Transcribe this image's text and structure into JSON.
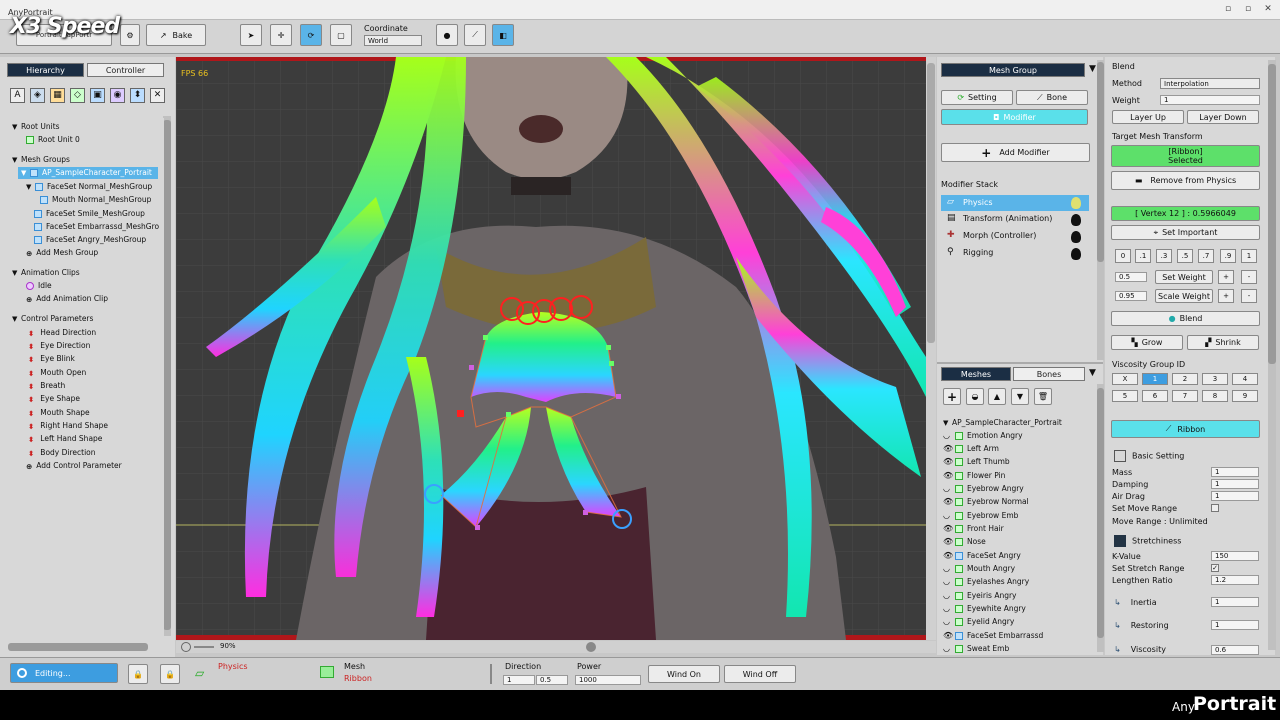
{
  "app": {
    "title": "AnyPortrait",
    "overlay": "X3 Speed"
  },
  "toolbar": {
    "portrait_tab": "Portrait (apPortr",
    "bake_label": "Bake",
    "coordinate_label": "Coordinate",
    "coordinate_value": "World"
  },
  "left": {
    "tabs": [
      "Hierarchy",
      "Controller"
    ],
    "root_units_header": "Root Units",
    "root_unit": "Root Unit 0",
    "mesh_groups_header": "Mesh Groups",
    "mesh_groups": [
      "AP_SampleCharacter_Portrait",
      "FaceSet Normal_MeshGroup",
      "Mouth Normal_MeshGroup",
      "FaceSet Smile_MeshGroup",
      "FaceSet Embarrassd_MeshGro",
      "FaceSet Angry_MeshGroup"
    ],
    "add_mesh_group": "Add Mesh Group",
    "animation_header": "Animation Clips",
    "animation_clips": [
      "Idle"
    ],
    "add_animation": "Add Animation Clip",
    "control_header": "Control Parameters",
    "control_params": [
      "Head Direction",
      "Eye Direction",
      "Eye Blink",
      "Mouth Open",
      "Breath",
      "Eye Shape",
      "Mouth Shape",
      "Right Hand Shape",
      "Left Hand Shape",
      "Body Direction"
    ],
    "add_control": "Add Control Parameter"
  },
  "viewport": {
    "fps": "FPS 66",
    "zoom": "90%"
  },
  "mid": {
    "header": "Mesh Group",
    "setting": "Setting",
    "bone": "Bone",
    "modifier": "Modifier",
    "add_modifier": "Add Modifier",
    "stack_label": "Modifier Stack",
    "modifiers": [
      "Physics",
      "Transform (Animation)",
      "Morph (Controller)",
      "Rigging"
    ],
    "meshes_tab": "Meshes",
    "bones_tab": "Bones",
    "mesh_root": "AP_SampleCharacter_Portrait",
    "meshes": [
      "Emotion Angry",
      "Left Arm",
      "Left Thumb",
      "Flower Pin",
      "Eyebrow Angry",
      "Eyebrow Normal",
      "Eyebrow Emb",
      "Front Hair",
      "Nose",
      "FaceSet Angry",
      "Mouth Angry",
      "Eyelashes Angry",
      "Eyeiris Angry",
      "Eyewhite Angry",
      "Eyelid Angry",
      "FaceSet Embarrassd",
      "Sweat Emb"
    ]
  },
  "right": {
    "blend_title": "Blend",
    "method_label": "Method",
    "method_value": "Interpolation",
    "weight_label": "Weight",
    "weight_value": "1",
    "layer_up": "Layer Up",
    "layer_down": "Layer Down",
    "target_label": "Target Mesh Transform",
    "target_line1": "[Ribbon]",
    "target_line2": "Selected",
    "remove_physics": "Remove from Physics",
    "vertex_label": "[ Vertex 12 ] : 0.5966049",
    "set_important": "Set Important",
    "weight_buttons": [
      "0",
      ".1",
      ".3",
      ".5",
      ".7",
      ".9",
      "1"
    ],
    "set_weight_value": "0.5",
    "set_weight": "Set Weight",
    "scale_weight_value": "0.95",
    "scale_weight": "Scale Weight",
    "blend_btn": "Blend",
    "grow": "Grow",
    "shrink": "Shrink",
    "viscosity_label": "Viscosity Group ID",
    "viscosity": [
      "X",
      "1",
      "2",
      "3",
      "4",
      "5",
      "6",
      "7",
      "8",
      "9"
    ],
    "ribbon_btn": "Ribbon",
    "basic_setting": "Basic Setting",
    "mass_label": "Mass",
    "mass_value": "1",
    "damping_label": "Damping",
    "damping_value": "1",
    "airdrag_label": "Air Drag",
    "airdrag_value": "1",
    "move_range_label": "Set Move Range",
    "move_range_value": "Move Range : Unlimited",
    "stretchiness": "Stretchiness",
    "kvalue_label": "K-Value",
    "kvalue_value": "150",
    "stretch_range_label": "Set Stretch Range",
    "lengthen_label": "Lengthen Ratio",
    "lengthen_value": "1.2",
    "inertia_label": "Inertia",
    "inertia_value": "1",
    "restoring_label": "Restoring",
    "restoring_value": "1",
    "viscosity2_label": "Viscosity",
    "viscosity2_value": "0.6"
  },
  "bottom": {
    "editing": "Editing...",
    "physics": "Physics",
    "mesh": "Mesh",
    "ribbon": "Ribbon",
    "direction_label": "Direction",
    "dir_x": "1",
    "dir_y": "0.5",
    "power_label": "Power",
    "power_value": "1000",
    "wind_on": "Wind On",
    "wind_off": "Wind Off"
  },
  "footer": {
    "logo_any": "Any",
    "logo_portrait": "Portrait"
  }
}
